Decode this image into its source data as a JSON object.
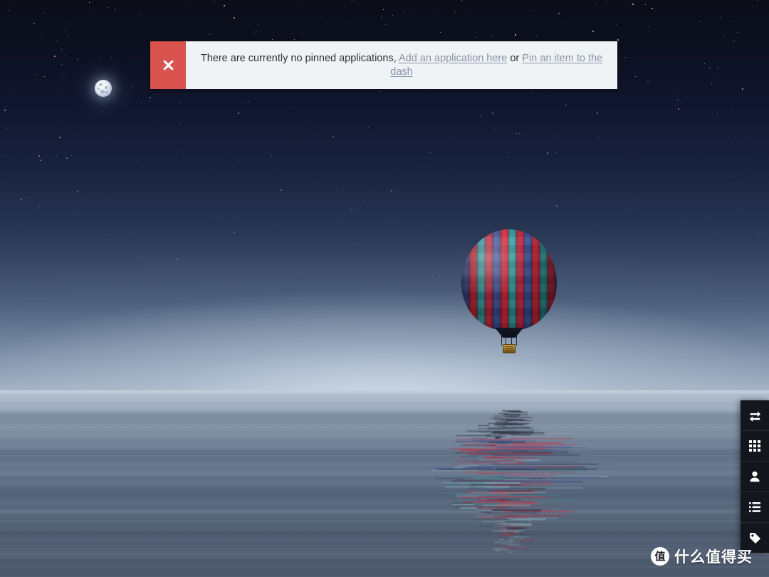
{
  "desktop": {
    "wallpaper_description": "night-sky-hot-air-balloon-over-water",
    "sky_top_color": "#0b0e18",
    "horizon_color": "#c3cedb",
    "water_color": "#5c6b81",
    "moon": {
      "name": "moon"
    },
    "balloon": {
      "name": "hot-air-balloon",
      "colors": [
        "#cf2436",
        "#2f8f94",
        "#3b4a8c"
      ]
    }
  },
  "notification": {
    "close_label": "✖",
    "close_bg": "#d9534f",
    "background": "#f0f3f5",
    "text_prefix": "There are currently no pinned applications,",
    "link_add": "Add an application here",
    "conjunction": " or ",
    "link_pin": "Pin an item to the dash",
    "link_color": "#8793a6",
    "text_color": "#2e3033"
  },
  "dock": {
    "background": "#14161d",
    "items": [
      {
        "id": "switch",
        "icon": "transfer-arrows-icon",
        "label": "Switch"
      },
      {
        "id": "apps",
        "icon": "grid-icon",
        "label": "Applications"
      },
      {
        "id": "user",
        "icon": "person-icon",
        "label": "User"
      },
      {
        "id": "list",
        "icon": "list-icon",
        "label": "List"
      },
      {
        "id": "tag",
        "icon": "tag-icon",
        "label": "Tag"
      }
    ]
  },
  "watermark": {
    "logo_char": "值",
    "text": "什么值得买"
  }
}
